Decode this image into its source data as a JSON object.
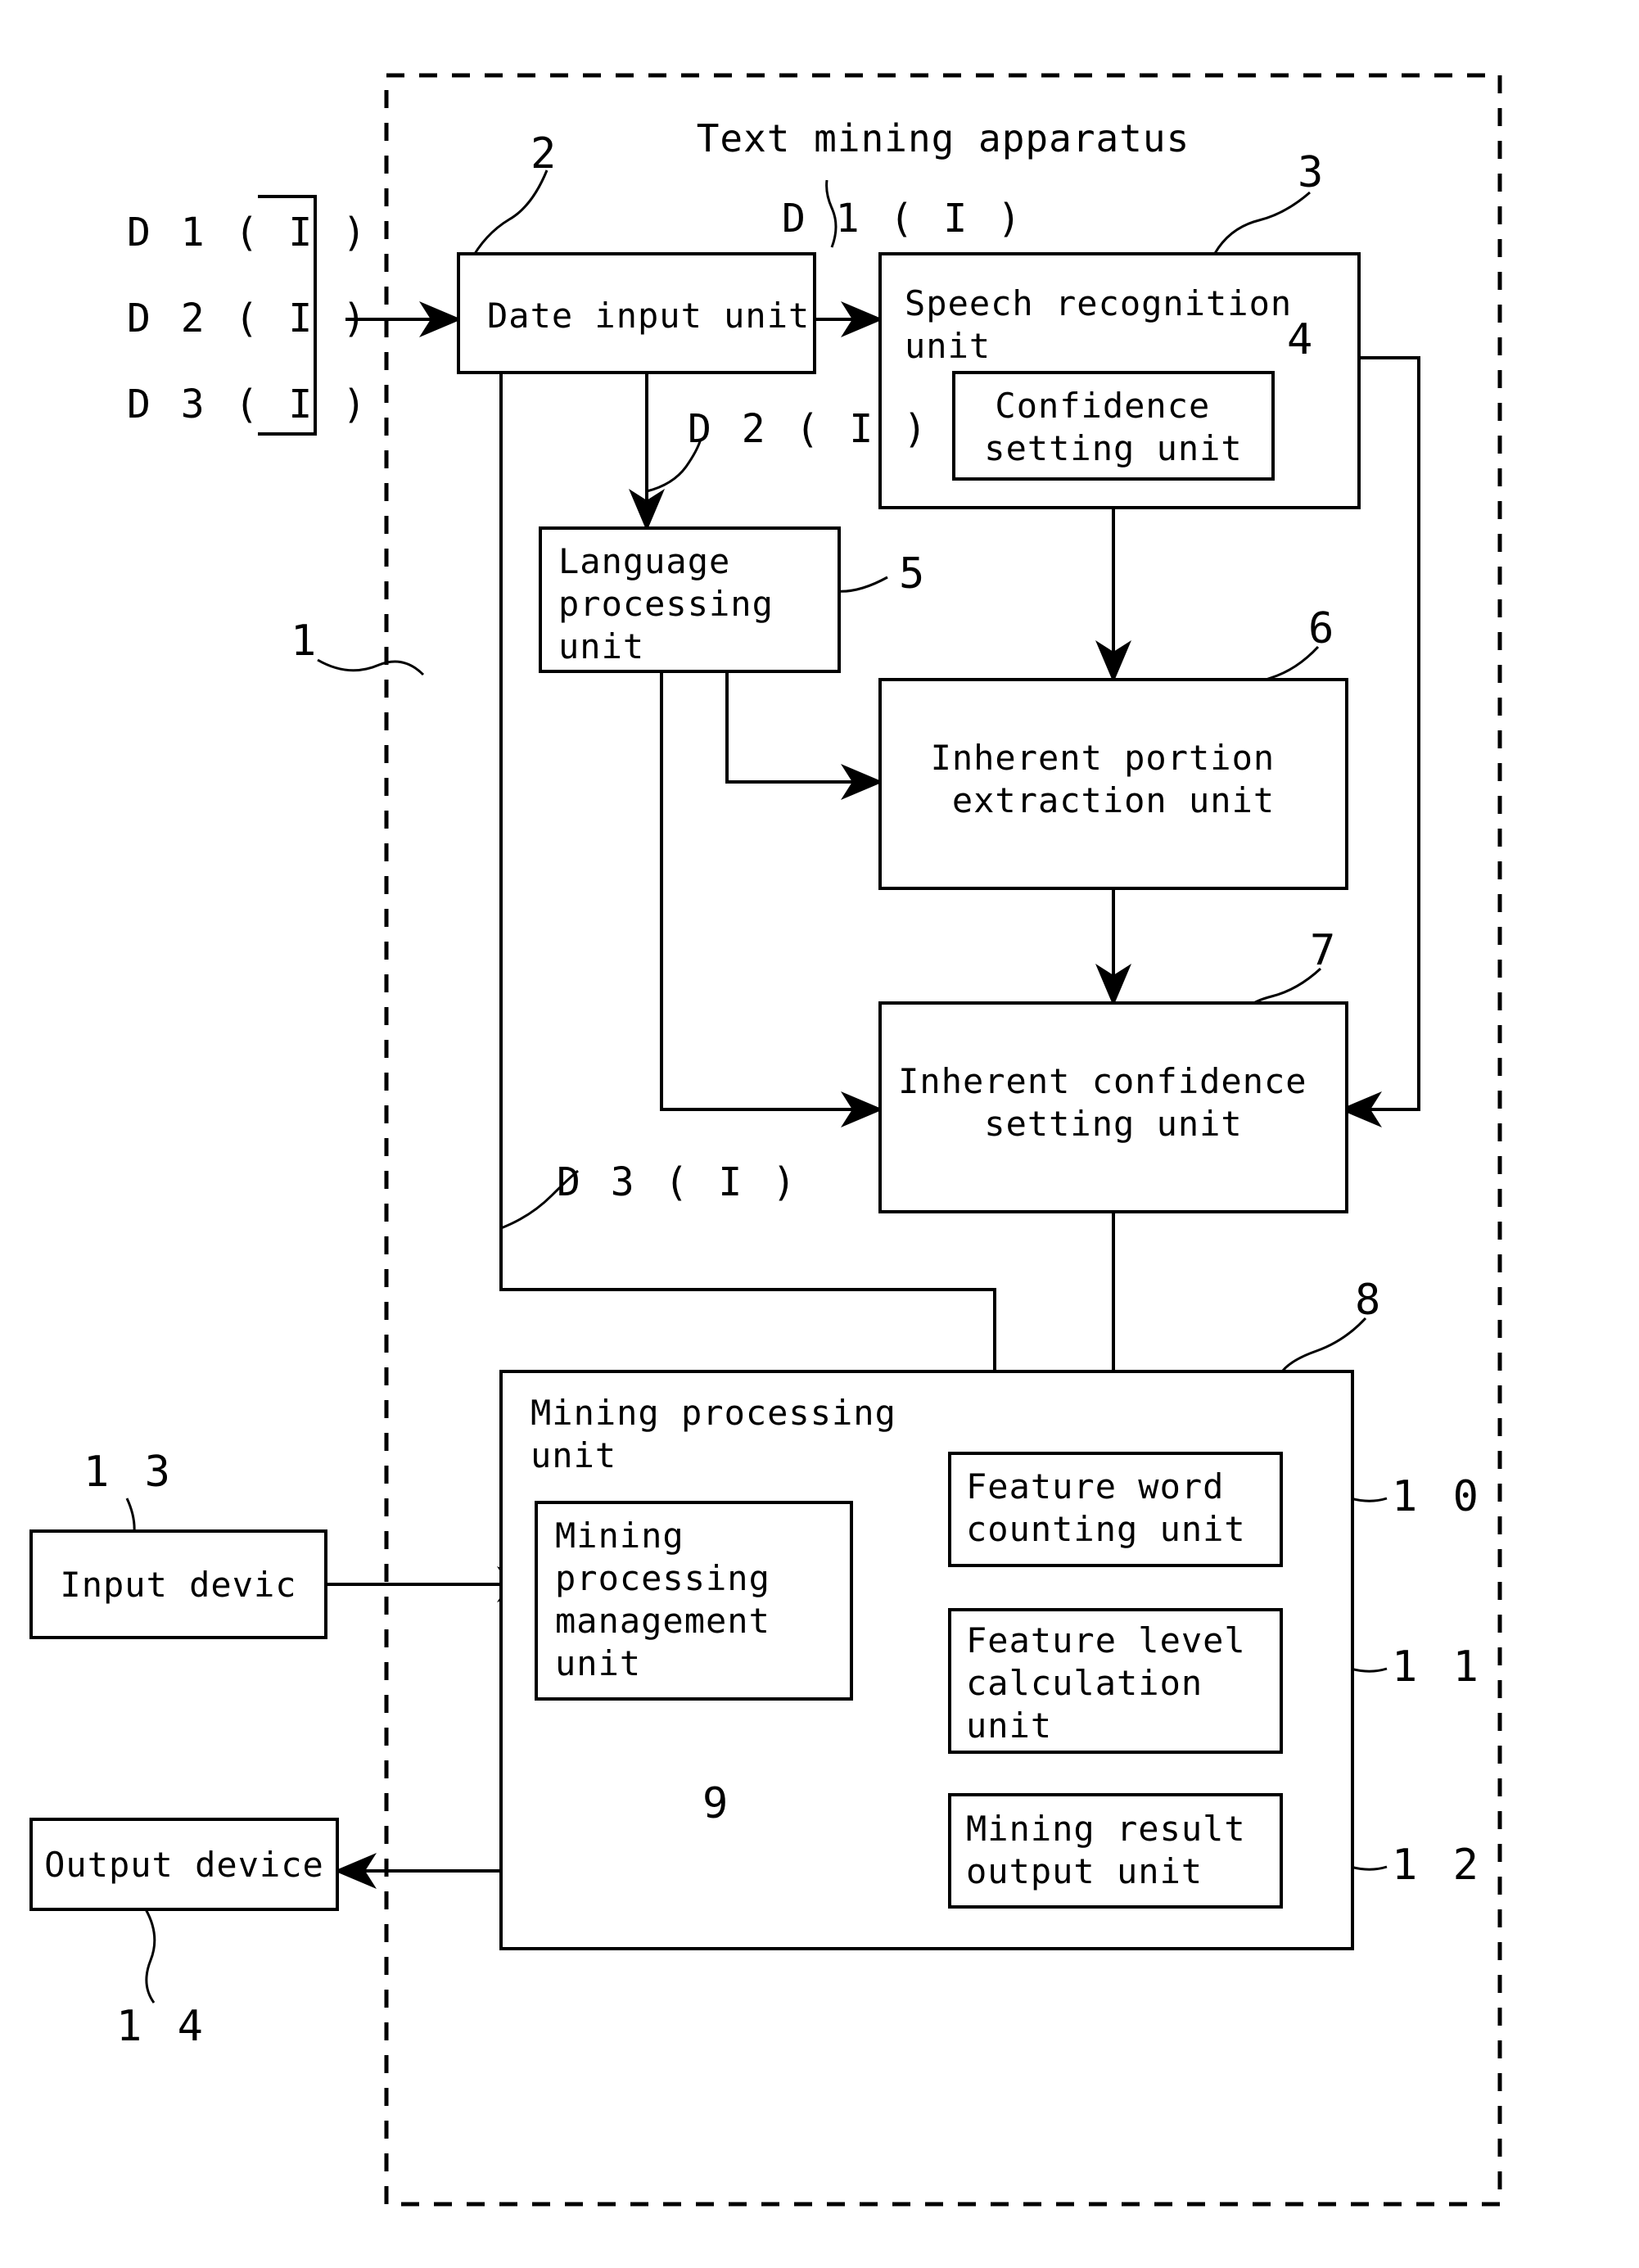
{
  "figure": {
    "apparatus_title": "Text mining apparatus",
    "apparatus_ref": "1"
  },
  "signals": {
    "d1_left": "D 1 ( I )",
    "d2_left": "D 2 ( I )",
    "d3_left": "D 3 ( I )",
    "d1_inner": "D 1 ( I )",
    "d2_inner": "D 2 ( I )",
    "d3_inner": "D 3 ( I )"
  },
  "blocks": {
    "date_input": {
      "label_line1": "Date input unit",
      "ref": "2"
    },
    "speech_recognition": {
      "label_line1": "Speech recognition",
      "label_line2": "unit",
      "ref": "3"
    },
    "confidence_setting": {
      "label_line1": "Confidence",
      "label_line2": "setting unit",
      "ref": "4"
    },
    "language_processing": {
      "label_line1": "Language",
      "label_line2": "processing",
      "label_line3": "unit",
      "ref": "5"
    },
    "inherent_portion_extraction": {
      "label_line1": "Inherent portion",
      "label_line2": "extraction unit",
      "ref": "6"
    },
    "inherent_confidence_setting": {
      "label_line1": "Inherent confidence",
      "label_line2": "setting unit",
      "ref": "7"
    },
    "mining_processing": {
      "label_line1": "Mining processing",
      "label_line2": "unit",
      "ref": "8"
    },
    "mining_processing_management": {
      "label_line1": "Mining",
      "label_line2": "processing",
      "label_line3": "management",
      "label_line4": "unit",
      "ref": "9"
    },
    "feature_word_counting": {
      "label_line1": "Feature word",
      "label_line2": "counting unit",
      "ref": "1 0"
    },
    "feature_level_calculation": {
      "label_line1": "Feature level",
      "label_line2": "calculation",
      "label_line3": "unit",
      "ref": "1 1"
    },
    "mining_result_output": {
      "label_line1": "Mining result",
      "label_line2": "output unit",
      "ref": "1 2"
    },
    "input_device": {
      "label_line1": "Input devic",
      "ref": "1 3"
    },
    "output_device": {
      "label_line1": "Output device",
      "ref": "1 4"
    }
  },
  "colors": {
    "ink": "#000000",
    "paper": "#ffffff"
  }
}
